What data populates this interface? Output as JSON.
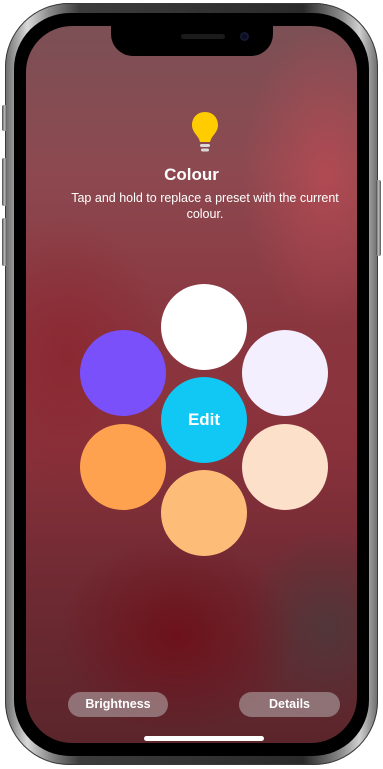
{
  "screen": {
    "title": "Colour",
    "subtitle": "Tap and hold to replace a preset with the current colour."
  },
  "icon": {
    "name": "lightbulb-icon",
    "color": "#ffcc00"
  },
  "presets": [
    {
      "name": "white",
      "color": "#ffffff"
    },
    {
      "name": "purple",
      "color": "#7a50fb"
    },
    {
      "name": "lavender-white",
      "color": "#f3efff"
    },
    {
      "name": "orange",
      "color": "#fea24f"
    },
    {
      "name": "peach",
      "color": "#fde0c9"
    },
    {
      "name": "light-orange",
      "color": "#fdbd79"
    }
  ],
  "edit": {
    "label": "Edit",
    "color": "#11c7f3"
  },
  "footer": {
    "brightness_label": "Brightness",
    "details_label": "Details"
  }
}
